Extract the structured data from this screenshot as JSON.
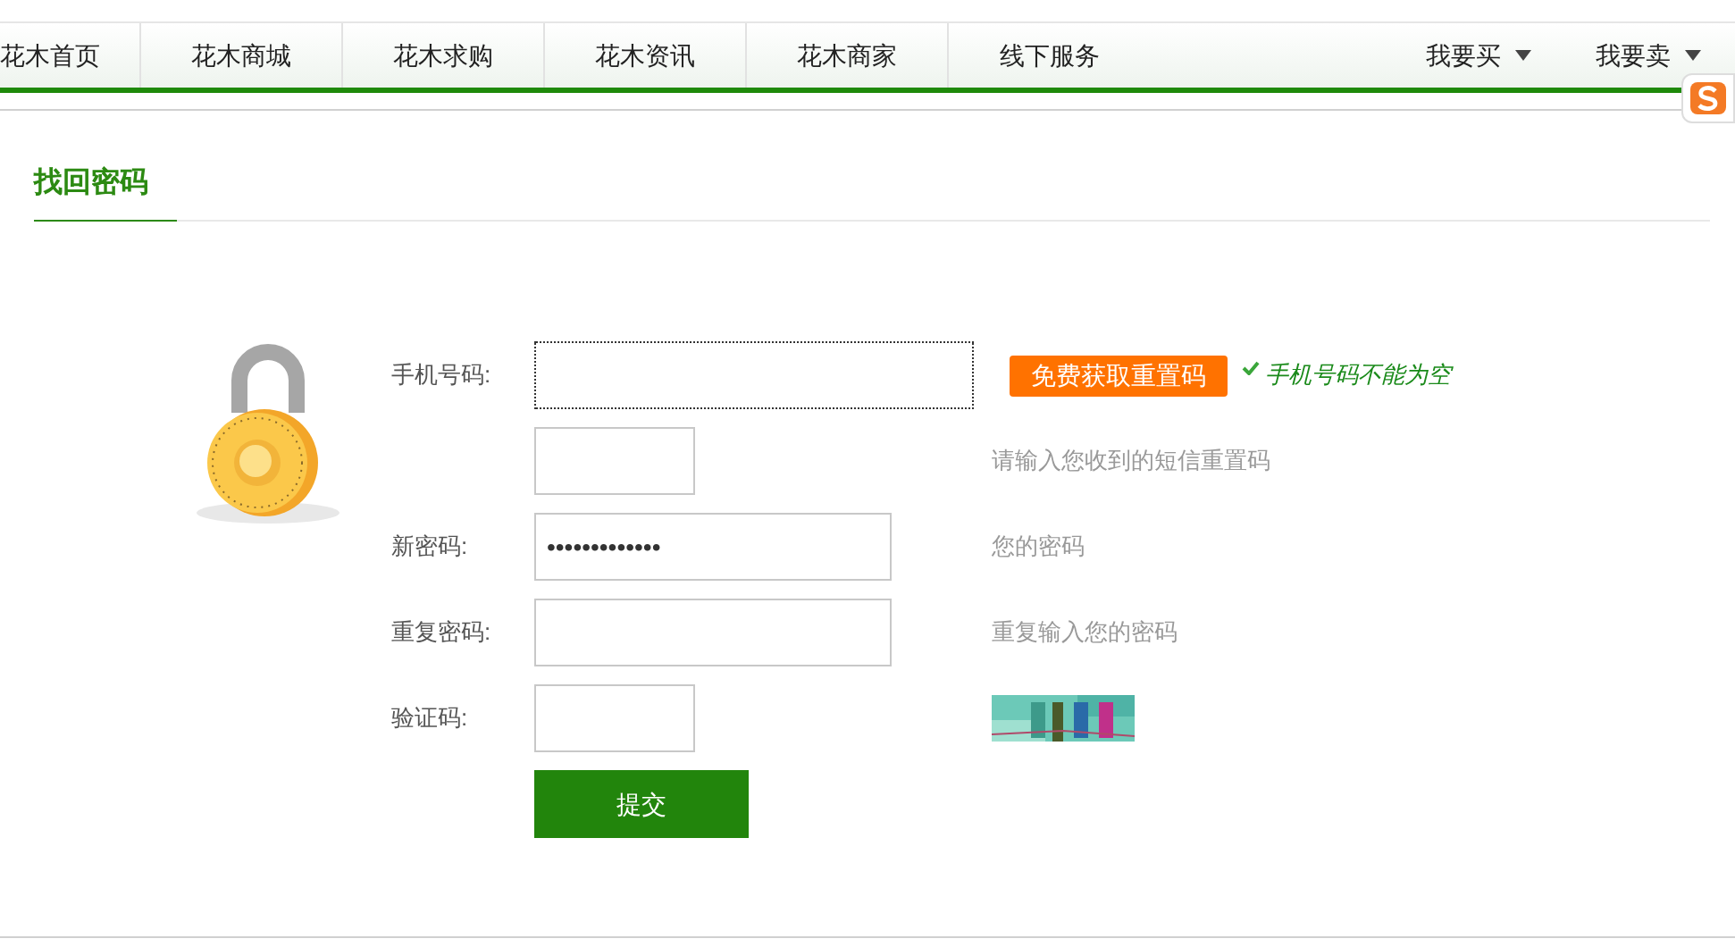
{
  "nav": {
    "items": [
      {
        "label": "花木首页"
      },
      {
        "label": "花木商城"
      },
      {
        "label": "花木求购"
      },
      {
        "label": "花木资讯"
      },
      {
        "label": "花木商家"
      },
      {
        "label": "线下服务"
      }
    ],
    "menus": [
      {
        "label": "我要买"
      },
      {
        "label": "我要卖"
      }
    ]
  },
  "page_title": "找回密码",
  "form": {
    "rows": [
      {
        "kind": "phone",
        "label": "手机号码:",
        "focused": true,
        "button": "免费获取重置码",
        "message": "手机号码不能为空"
      },
      {
        "kind": "code",
        "focused": false,
        "hint": "请输入您收到的短信重置码"
      },
      {
        "kind": "password",
        "label": "新密码:",
        "focused": false,
        "value": "•••••••••••••",
        "hint": "您的密码"
      },
      {
        "kind": "password",
        "label": "重复密码:",
        "focused": false,
        "hint": "重复输入您的密码"
      },
      {
        "kind": "captcha",
        "label": "验证码:",
        "focused": false
      }
    ],
    "submit": "提交"
  }
}
